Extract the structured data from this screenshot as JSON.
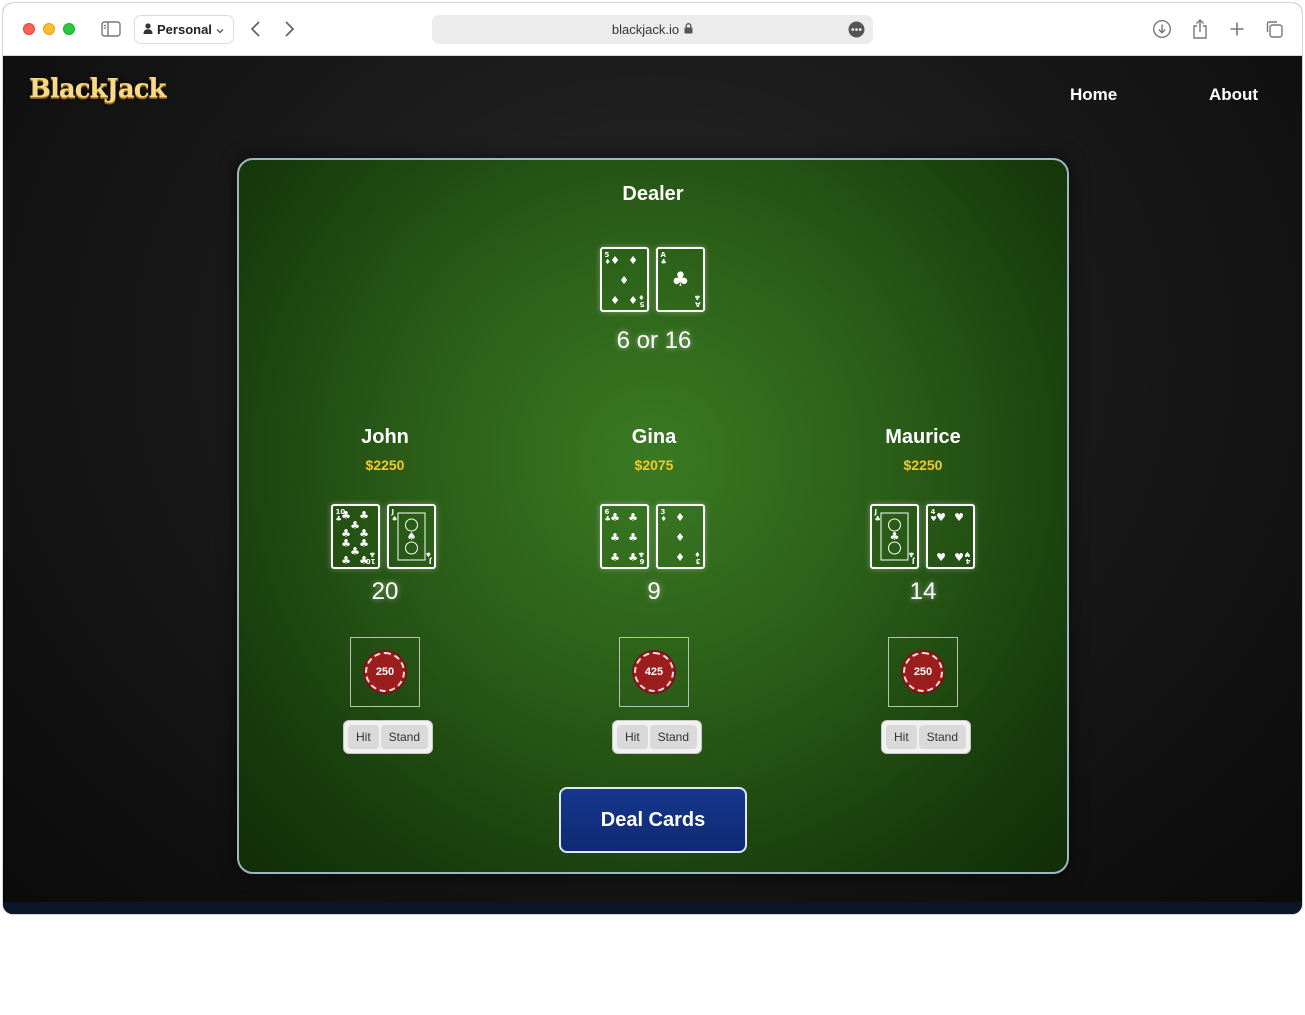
{
  "browser": {
    "profile_label": "Personal",
    "url": "blackjack.io"
  },
  "site": {
    "logo": "BlackJack",
    "nav": {
      "home": "Home",
      "about": "About"
    }
  },
  "dealer": {
    "title": "Dealer",
    "cards": [
      {
        "rank": "5",
        "suit": "diamonds"
      },
      {
        "rank": "A",
        "suit": "clubs"
      }
    ],
    "score": "6 or 16"
  },
  "players": [
    {
      "name": "John",
      "money": "$2250",
      "cards": [
        {
          "rank": "10",
          "suit": "clubs"
        },
        {
          "rank": "J",
          "suit": "spades"
        }
      ],
      "score": "20",
      "bet": "250",
      "hit_label": "Hit",
      "stand_label": "Stand"
    },
    {
      "name": "Gina",
      "money": "$2075",
      "cards": [
        {
          "rank": "6",
          "suit": "clubs"
        },
        {
          "rank": "3",
          "suit": "diamonds"
        }
      ],
      "score": "9",
      "bet": "425",
      "hit_label": "Hit",
      "stand_label": "Stand"
    },
    {
      "name": "Maurice",
      "money": "$2250",
      "cards": [
        {
          "rank": "J",
          "suit": "clubs"
        },
        {
          "rank": "4",
          "suit": "hearts"
        }
      ],
      "score": "14",
      "bet": "250",
      "hit_label": "Hit",
      "stand_label": "Stand"
    }
  ],
  "deal_label": "Deal Cards"
}
